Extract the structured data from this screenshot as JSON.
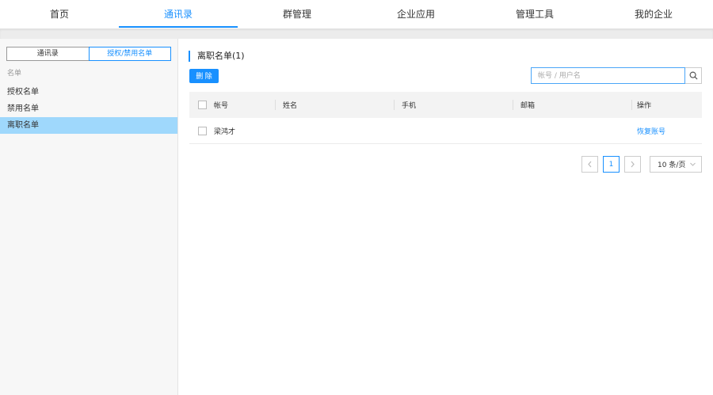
{
  "topnav": {
    "items": [
      {
        "label": "首页"
      },
      {
        "label": "通讯录"
      },
      {
        "label": "群管理"
      },
      {
        "label": "企业应用"
      },
      {
        "label": "管理工具"
      },
      {
        "label": "我的企业"
      }
    ],
    "active_index": 1
  },
  "sidebar": {
    "toggle": [
      "通讯录",
      "授权/禁用名单"
    ],
    "toggle_active": 1,
    "section_label": "名单",
    "items": [
      {
        "label": "授权名单"
      },
      {
        "label": "禁用名单"
      },
      {
        "label": "离职名单"
      }
    ],
    "active_index": 2
  },
  "main": {
    "title": "离职名单(1)",
    "delete_label": "删 除",
    "search": {
      "placeholder": "帐号 / 用户名",
      "value": "",
      "icon": "search-icon"
    },
    "table": {
      "columns": [
        "帐号",
        "姓名",
        "手机",
        "邮箱",
        "操作"
      ],
      "rows": [
        {
          "account": "梁鸿才",
          "name": "",
          "phone": "",
          "email": "",
          "action": "恢复账号"
        }
      ]
    },
    "pagination": {
      "current_page": "1",
      "page_size": "10 条/页"
    }
  },
  "colors": {
    "accent": "#1890ff",
    "selected_row": "#9fd8fc",
    "sidebar_bg": "#f7f7f7"
  }
}
